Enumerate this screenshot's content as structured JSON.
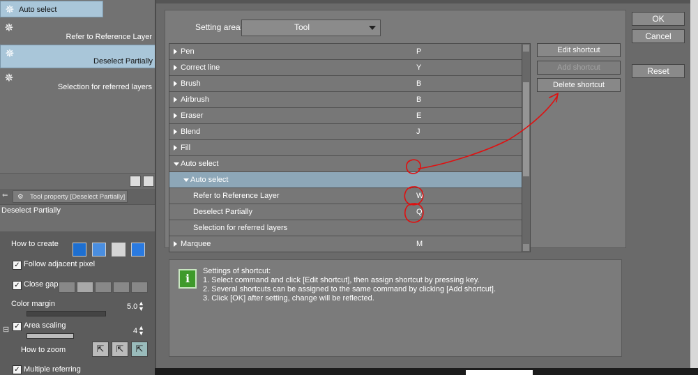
{
  "left_panel": {
    "subtools": [
      {
        "label": "Auto select",
        "icon": "magic-wand-icon",
        "state": "selected"
      },
      {
        "label": "Refer to Reference Layer",
        "icon": "magic-wand-icon",
        "state": "normal"
      },
      {
        "label": "Deselect Partially",
        "icon": "magic-wand-icon",
        "state": "selected"
      },
      {
        "label": "Selection for referred layers",
        "icon": "magic-wand-icon",
        "state": "normal"
      }
    ],
    "tool_property_tab": "Tool property [Deselect Partially]",
    "property_title": "Deselect Partially",
    "properties": {
      "how_to_create": "How to create",
      "follow_adjacent": "Follow adjacent pixel",
      "close_gap": "Close gap",
      "color_margin": "Color margin",
      "color_margin_value": "5.0",
      "area_scaling": "Area scaling",
      "area_scaling_value": "4",
      "how_to_zoom": "How to zoom",
      "multiple_referring": "Multiple referring"
    }
  },
  "dialog": {
    "setting_area_label": "Setting area:",
    "setting_area_value": "Tool",
    "rows": [
      {
        "name": "Pen",
        "key": "P",
        "level": 0,
        "expanded": false
      },
      {
        "name": "Correct line",
        "key": "Y",
        "level": 0,
        "expanded": false
      },
      {
        "name": "Brush",
        "key": "B",
        "level": 0,
        "expanded": false
      },
      {
        "name": "Airbrush",
        "key": "B",
        "level": 0,
        "expanded": false
      },
      {
        "name": "Eraser",
        "key": "E",
        "level": 0,
        "expanded": false
      },
      {
        "name": "Blend",
        "key": "J",
        "level": 0,
        "expanded": false
      },
      {
        "name": "Fill",
        "key": "",
        "level": 0,
        "expanded": false
      },
      {
        "name": "Auto select",
        "key": "",
        "level": 0,
        "expanded": true
      },
      {
        "name": "Auto select",
        "key": "",
        "level": 1,
        "expanded": true,
        "selected": true
      },
      {
        "name": "Refer to Reference Layer",
        "key": "W",
        "level": 2
      },
      {
        "name": "Deselect Partially",
        "key": "Q",
        "level": 2
      },
      {
        "name": "Selection for referred layers",
        "key": "",
        "level": 2
      },
      {
        "name": "Marquee",
        "key": "M",
        "level": 0,
        "expanded": false
      }
    ],
    "buttons": {
      "edit_shortcut": "Edit shortcut",
      "add_shortcut": "Add shortcut",
      "delete_shortcut": "Delete shortcut",
      "ok": "OK",
      "cancel": "Cancel",
      "reset": "Reset"
    },
    "info": {
      "icon": "info-icon",
      "icon_glyph": "i",
      "text": "Settings of shortcut:\n1. Select command and click [Edit shortcut], then assign shortcut by pressing key.\n2. Several shortcuts can be assigned to the same command by clicking [Add shortcut].\n3. Click [OK] after setting, change will be reflected."
    }
  },
  "annotation_color": "#e01010"
}
